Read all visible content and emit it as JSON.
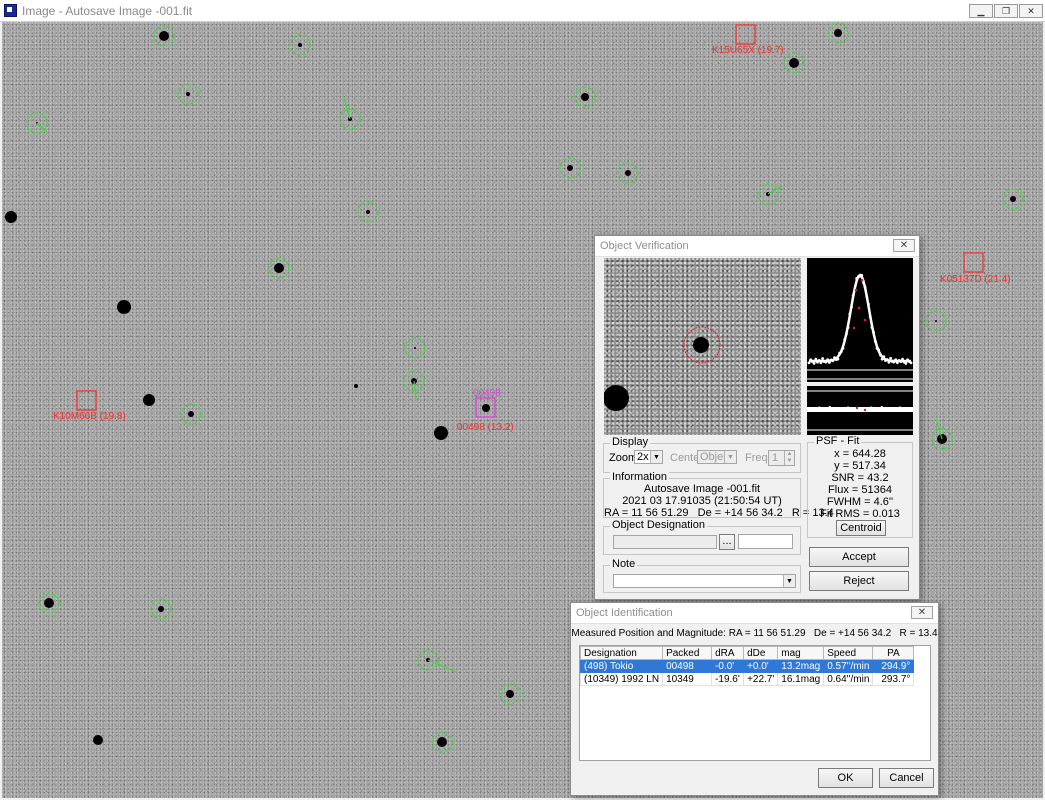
{
  "window": {
    "title": "Image - Autosave Image -001.fit",
    "controls": [
      "minimize-icon",
      "restore-icon",
      "close-icon"
    ]
  },
  "image_labels": {
    "target_top": "00498",
    "target_bottom": "00498 (13.2)",
    "k15u65x": "K15U65X (19.7)",
    "k05137d": "K05137D (21.4)",
    "k10m66b": "K10M66B (19.8)"
  },
  "colors": {
    "known_object": "#ff2a2a",
    "selected_object": "#e040e0",
    "detected_star": "#33dd33",
    "selection_blue": "#2f78d5"
  },
  "verification": {
    "title": "Object Verification",
    "display": {
      "group": "Display",
      "zoom_label": "Zoom",
      "zoom_value": "2x",
      "center_label": "Center",
      "center_value": "Object",
      "freq_label": "Freq.",
      "freq_value": "1"
    },
    "information": {
      "group": "Information",
      "file": "Autosave Image -001.fit",
      "date": "2021 03 17.91035 (21:50:54 UT)",
      "coords": "RA = 11 56 51.29   De = +14 56 34.2   R = 13.4"
    },
    "designation": {
      "group": "Object Designation",
      "browse": "..."
    },
    "note": {
      "group": "Note"
    },
    "psf": {
      "group": "PSF - Fit",
      "x": "x = 644.28",
      "y": "y = 517.34",
      "snr": "SNR = 43.2",
      "flux": "Flux = 51364",
      "fwhm": "FWHM = 4.6''",
      "fitrms": "Fit RMS = 0.013"
    },
    "buttons": {
      "centroid": "Centroid",
      "accept": "Accept",
      "reject": "Reject"
    }
  },
  "identification": {
    "title": "Object Identification",
    "measured": "Measured Position and Magnitude: RA = 11 56 51.29   De = +14 56 34.2   R = 13.4",
    "columns": [
      "Designation",
      "Packed",
      "dRA",
      "dDe",
      "mag",
      "Speed",
      "PA"
    ],
    "rows": [
      [
        "(498) Tokio",
        "00498",
        "-0.0'",
        "+0.0'",
        "13.2mag",
        "0.57''/min",
        "294.9°"
      ],
      [
        "(10349) 1992 LN",
        "10349",
        "-19.6'",
        "+22.7'",
        "16.1mag",
        "0.64''/min",
        "293.7°"
      ]
    ],
    "ok": "OK",
    "cancel": "Cancel"
  }
}
